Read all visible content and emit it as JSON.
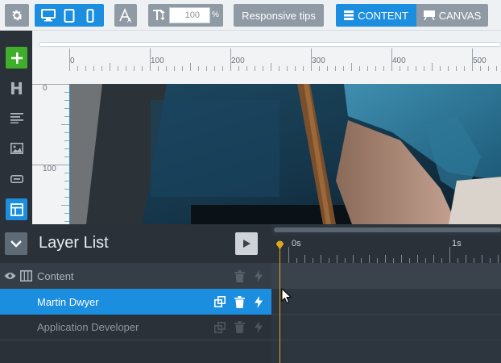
{
  "toolbar": {
    "font_size_value": "100",
    "font_size_unit": "%",
    "responsive_tips_label": "Responsive tips",
    "content_tab_label": "CONTENT",
    "canvas_tab_label": "CANVAS"
  },
  "sidebar": {
    "items": [
      {
        "icon": "plus-icon"
      },
      {
        "icon": "heading-icon",
        "glyph": "H"
      },
      {
        "icon": "text-lines-icon"
      },
      {
        "icon": "image-icon"
      },
      {
        "icon": "button-icon"
      },
      {
        "icon": "layout-icon"
      }
    ]
  },
  "rulers": {
    "horizontal": [
      "0",
      "100",
      "200",
      "300",
      "400",
      "500"
    ],
    "vertical": [
      "0",
      "100"
    ]
  },
  "layer_panel": {
    "title": "Layer List",
    "layers": [
      {
        "label": "Content"
      },
      {
        "label": "Martin Dwyer"
      },
      {
        "label": "Application Developer"
      }
    ]
  },
  "timeline": {
    "labels": [
      "0s",
      "1s"
    ]
  },
  "colors": {
    "accent": "#1c8ee0",
    "add_green": "#3fae2a",
    "playhead": "#e0a820"
  }
}
